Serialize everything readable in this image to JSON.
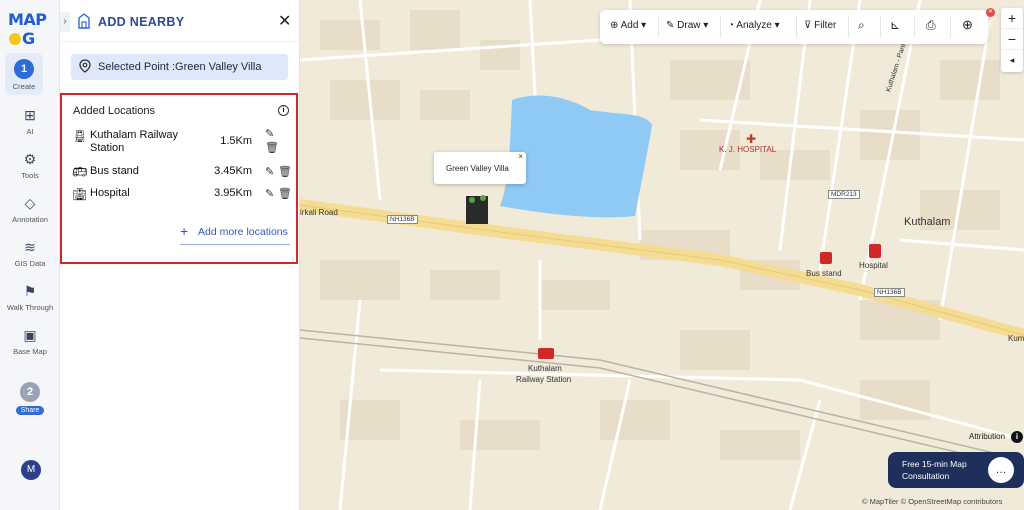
{
  "app": {
    "logo": "MAPOG"
  },
  "rail": {
    "items": [
      {
        "label": "Create",
        "badge": "1"
      },
      {
        "label": "AI"
      },
      {
        "label": "Tools"
      },
      {
        "label": "Annotation"
      },
      {
        "label": "GIS Data"
      },
      {
        "label": "Walk Through"
      },
      {
        "label": "Base Map"
      },
      {
        "label": "Share",
        "badge": "2"
      }
    ],
    "avatar": "M"
  },
  "panel": {
    "collapse": "›",
    "title": "ADD NEARBY",
    "close": "✕",
    "selected_point": "Selected Point :Green Valley Villa",
    "added_title": "Added Locations",
    "info": "i",
    "locations": [
      {
        "name": "Kuthalam Railway Station",
        "distance": "1.5Km",
        "icon": "train-icon"
      },
      {
        "name": "Bus stand",
        "distance": "3.45Km",
        "icon": "bus-icon"
      },
      {
        "name": "Hospital",
        "distance": "3.95Km",
        "icon": "hospital-icon"
      }
    ],
    "add_more": "Add more locations"
  },
  "toolbar": {
    "add": "Add",
    "draw": "Draw",
    "analyze": "Analyze",
    "filter": "Filter"
  },
  "zoom": {
    "in": "+",
    "out": "−",
    "reset": "◂"
  },
  "map": {
    "popup": "Green Valley Villa",
    "popup_close": "×",
    "labels": {
      "hospital_top": "K. J. HOSPITAL",
      "town": "Kuthalam",
      "bus_stand": "Bus stand",
      "hospital": "Hospital",
      "railway_1": "Kuthalam",
      "railway_2": "Railway Station",
      "road_left": "irkali Road",
      "road_right": "Kuthalam - Panthal",
      "edge": "Kum"
    },
    "shields": [
      "NH136B",
      "MDR213",
      "NH136B"
    ],
    "colors": {
      "water": "#8fcaf5",
      "highway": "#f5dc93",
      "land": "#f2ead9",
      "accent": "#2f6bd9",
      "marker": "#d32626"
    }
  },
  "attribution": {
    "label": "Attribution",
    "icon": "i"
  },
  "consult": {
    "line1": "Free 15-min Map",
    "line2": "Consultation"
  },
  "copyright": "© MapTiler © OpenStreetMap contributors"
}
